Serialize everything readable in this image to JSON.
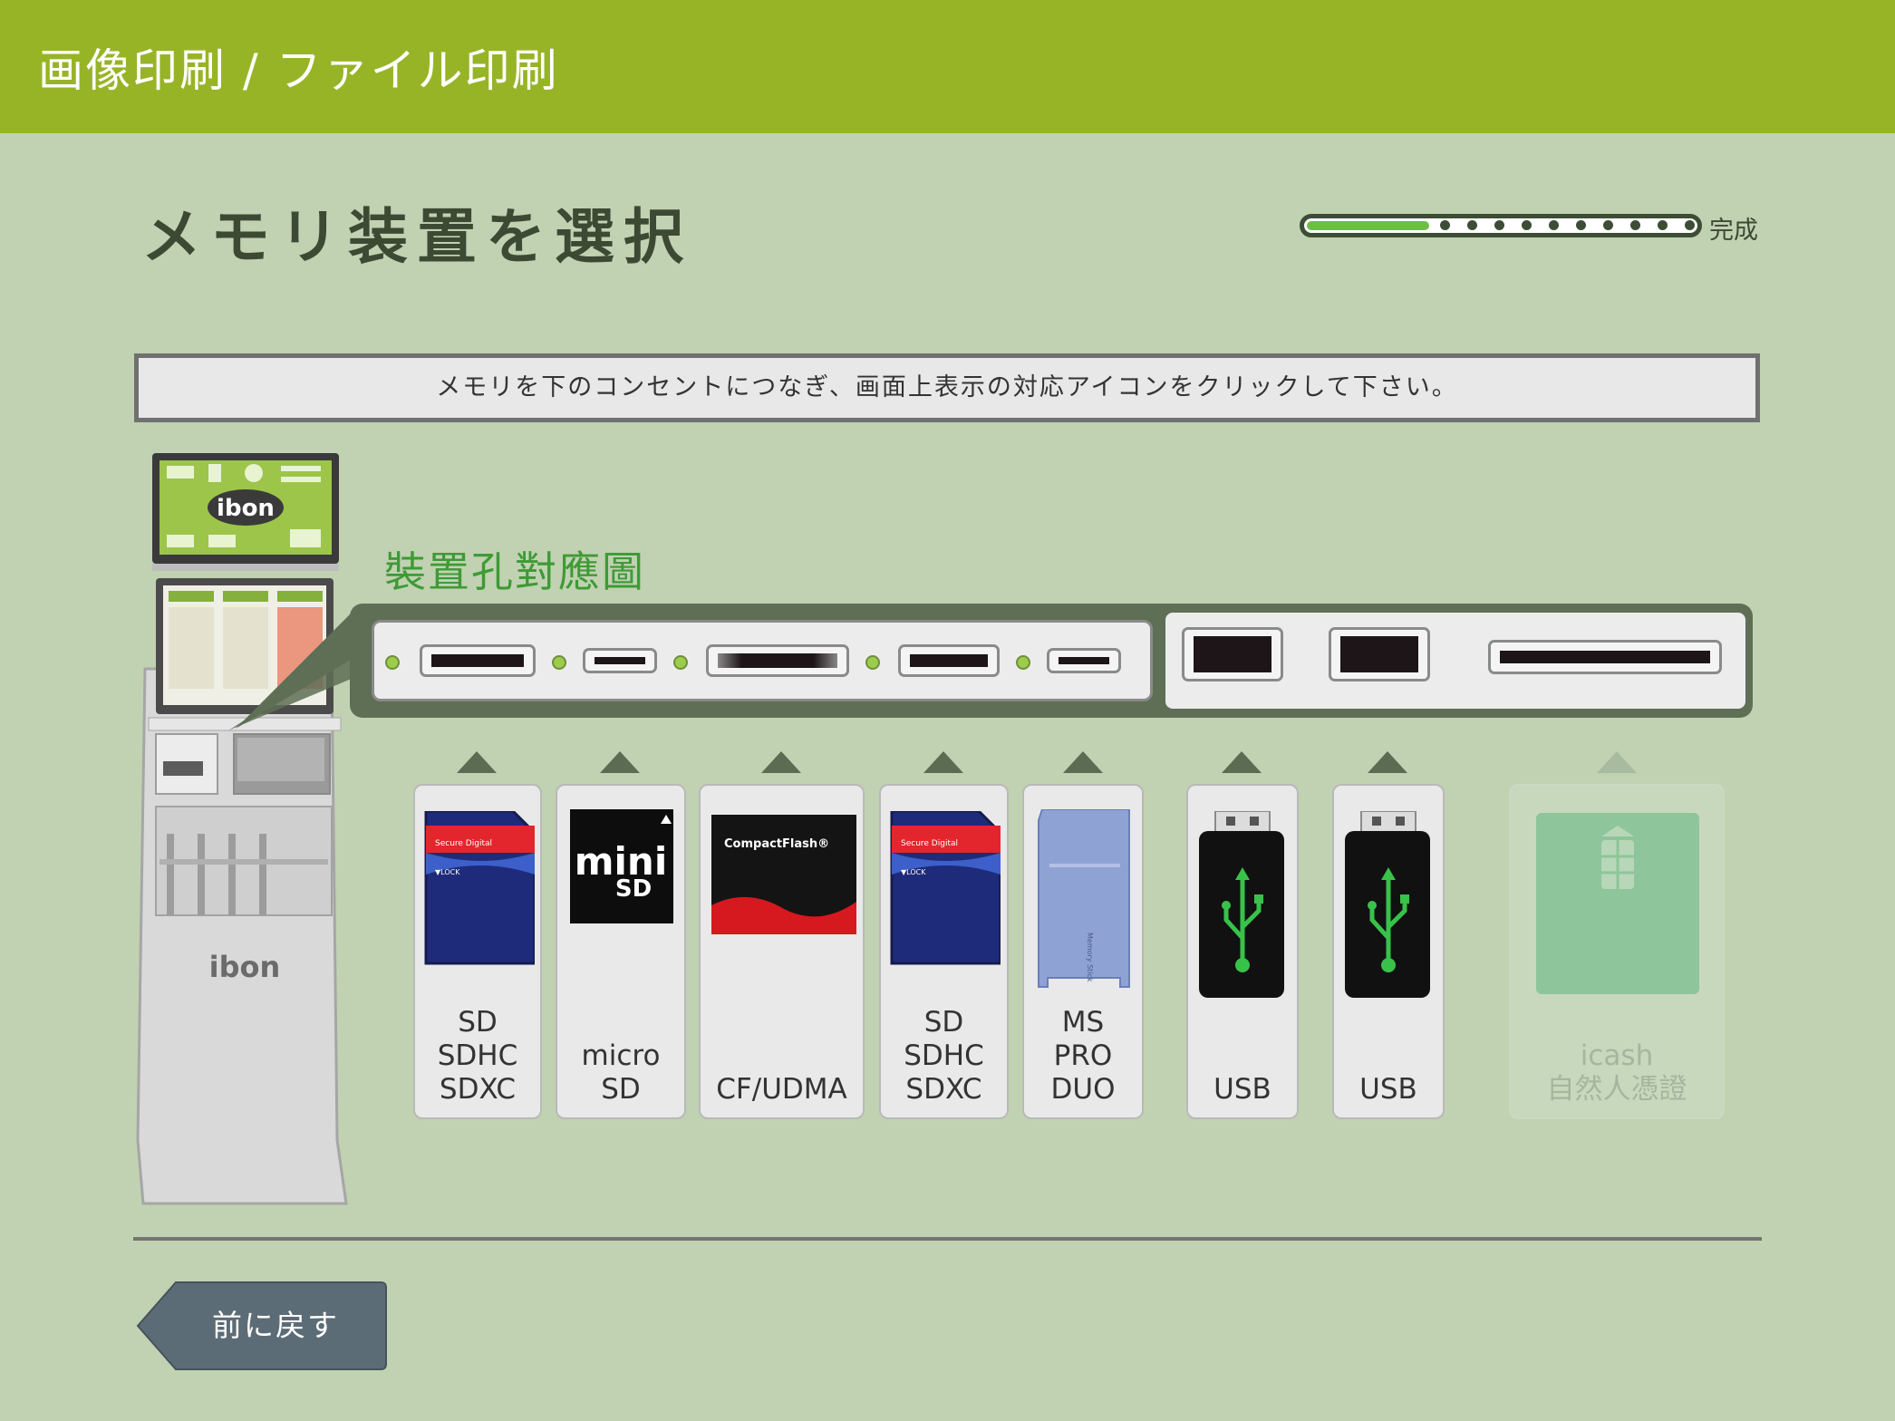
{
  "header": {
    "title": "画像印刷 / ファイル印刷"
  },
  "page": {
    "title": "メモリ装置を選択"
  },
  "progress": {
    "label": "完成",
    "step": 1,
    "total_steps": 10
  },
  "instruction": "メモリを下のコンセントにつなぎ、画面上表示の対応アイコンをクリックして下さい。",
  "device_map": {
    "title": "裝置孔對應圖"
  },
  "kiosk": {
    "brand": "ibon"
  },
  "devices": [
    {
      "label": "SD\nSDHC\nSDXC",
      "icon": "sd-card-icon",
      "enabled": true
    },
    {
      "label": "micro SD",
      "icon": "minisd-card-icon",
      "enabled": true
    },
    {
      "label": "CF/UDMA",
      "icon": "compactflash-card-icon",
      "enabled": true
    },
    {
      "label": "SD\nSDHC\nSDXC",
      "icon": "sd-card-icon",
      "enabled": true
    },
    {
      "label": "MS\nPRO\nDUO",
      "icon": "memory-stick-icon",
      "enabled": true
    },
    {
      "label": "USB",
      "icon": "usb-drive-icon",
      "enabled": true
    },
    {
      "label": "USB",
      "icon": "usb-drive-icon",
      "enabled": true
    },
    {
      "label": "icash\n自然人憑證",
      "icon": "smart-card-icon",
      "enabled": false
    }
  ],
  "card_art_text": {
    "sd": "Secure Digital",
    "sd_lock": "▼LOCK",
    "cf": "CompactFlash®",
    "ms": "Memory Stick"
  },
  "back_button": {
    "label": "前に戻す"
  },
  "colors": {
    "header": "#97b427",
    "background": "#c0d2b2",
    "accent_green": "#3e9a35",
    "progress_fill": "#6cbe45"
  }
}
